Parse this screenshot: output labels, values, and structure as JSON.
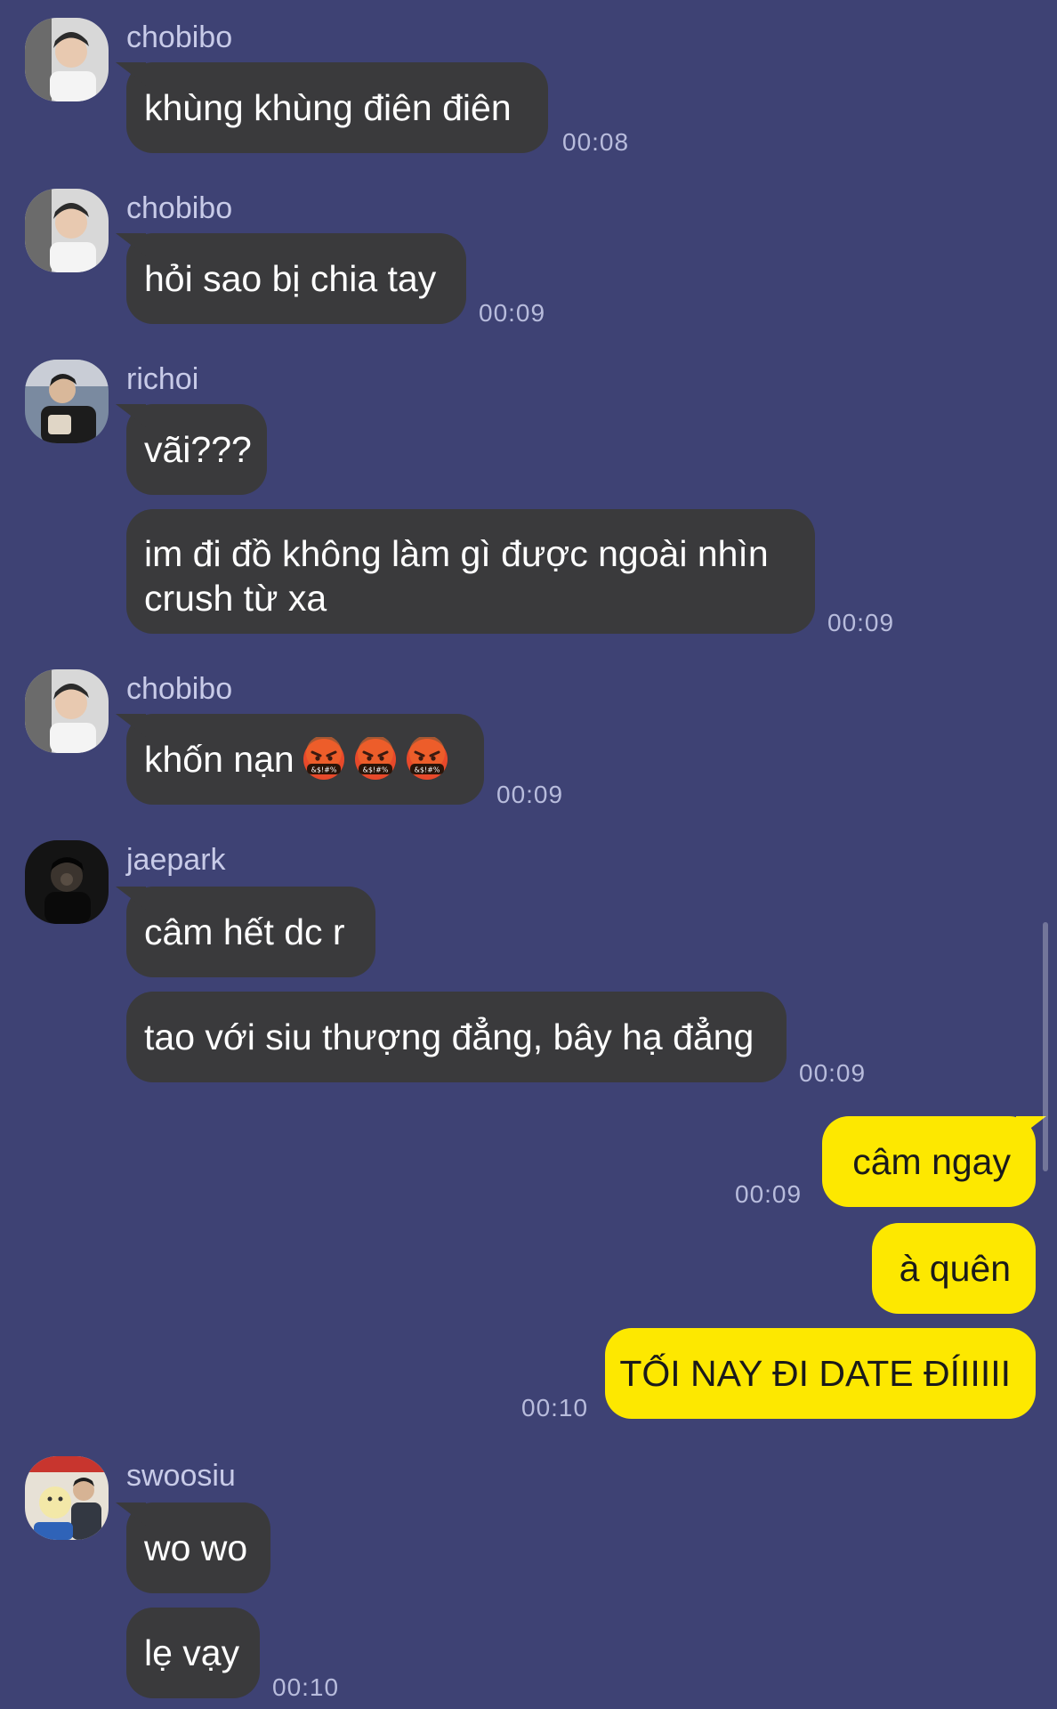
{
  "messages": [
    {
      "sender": "chobibo",
      "text": "khùng khùng điên điên",
      "time": "00:08"
    },
    {
      "sender": "chobibo",
      "text": "hỏi sao bị chia tay",
      "time": "00:09"
    },
    {
      "sender": "richoi",
      "text": "vãi???"
    },
    {
      "text": "im đi đồ không làm gì được ngoài nhìn crush từ xa",
      "time": "00:09"
    },
    {
      "sender": "chobibo",
      "text": "khốn nạn",
      "emoji": "face-with-symbols-on-mouth",
      "emoji_count": 3,
      "time": "00:09"
    },
    {
      "sender": "jaepark",
      "text": "câm hết dc r"
    },
    {
      "text": "tao với siu thượng đẳng, bây hạ đẳng",
      "time": "00:09"
    },
    {
      "me": true,
      "text": "câm ngay",
      "time": "00:09"
    },
    {
      "me": true,
      "text": "à quên"
    },
    {
      "me": true,
      "text": "TỐI NAY ĐI DATE ĐÍIIIII",
      "time": "00:10"
    },
    {
      "sender": "swoosiu",
      "text": "wo wo"
    },
    {
      "text": "lẹ vạy",
      "time": "00:10"
    }
  ],
  "colors": {
    "background": "#3e4274",
    "incoming_bubble": "#3a3a3c",
    "outgoing_bubble": "#fde800",
    "sender_name": "#c8cbe8",
    "timestamp": "#b8bcdc"
  }
}
